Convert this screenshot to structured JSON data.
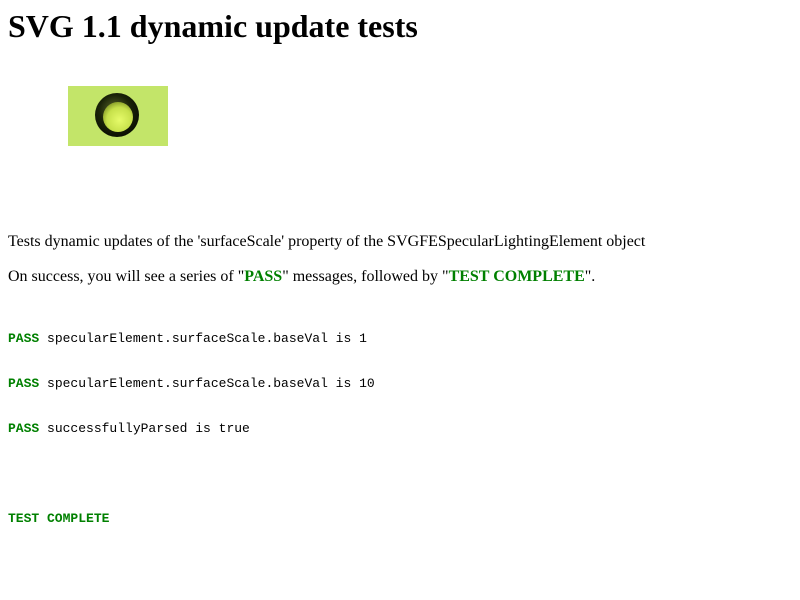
{
  "title": "SVG 1.1 dynamic update tests",
  "svg_demo": {
    "background_color": "#c3e569",
    "ring_color": "#1e2a05",
    "center_color": "#d9f25a"
  },
  "description": "Tests dynamic updates of the 'surfaceScale' property of the SVGFESpecularLightingElement object",
  "success_message": {
    "prefix": "On success, you will see a series of \"",
    "pass_word": "PASS",
    "middle": "\" messages, followed by \"",
    "complete_word": "TEST COMPLETE",
    "suffix": "\"."
  },
  "results": [
    {
      "status": "PASS",
      "text": " specularElement.surfaceScale.baseVal is 1"
    },
    {
      "status": "PASS",
      "text": " specularElement.surfaceScale.baseVal is 10"
    },
    {
      "status": "PASS",
      "text": " successfullyParsed is true"
    }
  ],
  "final_status": "TEST COMPLETE",
  "colors": {
    "pass_green": "#008000"
  }
}
